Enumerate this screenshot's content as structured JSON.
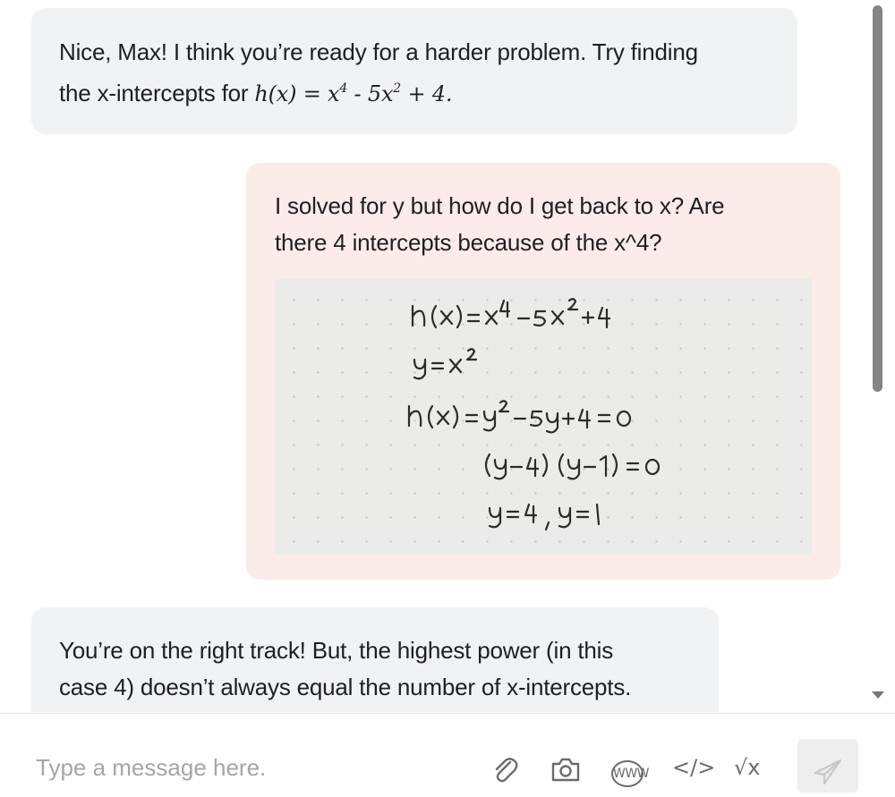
{
  "messages": [
    {
      "role": "tutor",
      "line1": "Nice, Max! I think you’re ready for a harder problem. Try finding",
      "line2_prefix": "the x-intercepts for ",
      "formula_parts": [
        "h(x)",
        " = ",
        "x",
        "4",
        " - 5",
        "x",
        "2",
        " + 4."
      ]
    },
    {
      "role": "student",
      "line1": "I solved for y but how do I get back to x? Are",
      "line2": "there 4 intercepts because of the x^4?",
      "handwritten_lines": [
        "h(x) = x⁴ − 5x² + 4",
        "y = x²",
        "h(x) = y² − 5y + 4 = 0",
        "(y − 4)(y − 1) = 0",
        "y = 4 , y = 1"
      ]
    },
    {
      "role": "tutor",
      "line1": "You’re on the right track! But, the highest power (in this",
      "line2": "case 4) doesn’t always equal the number of x-intercepts."
    }
  ],
  "composer": {
    "placeholder": "Type a message here.",
    "tools": [
      {
        "icon": "paperclip-icon"
      },
      {
        "icon": "camera-icon"
      },
      {
        "icon": "web-icon",
        "text": "WWW"
      },
      {
        "icon": "code-icon",
        "text": "</>"
      },
      {
        "icon": "square-root-icon",
        "text": "√x"
      },
      {
        "icon": "send-icon"
      }
    ]
  },
  "colors": {
    "tutor_bubble": "#f1f2f4",
    "student_bubble": "#fbecea",
    "placeholder": "#a6a6a6",
    "icon": "#6b6b6b"
  }
}
